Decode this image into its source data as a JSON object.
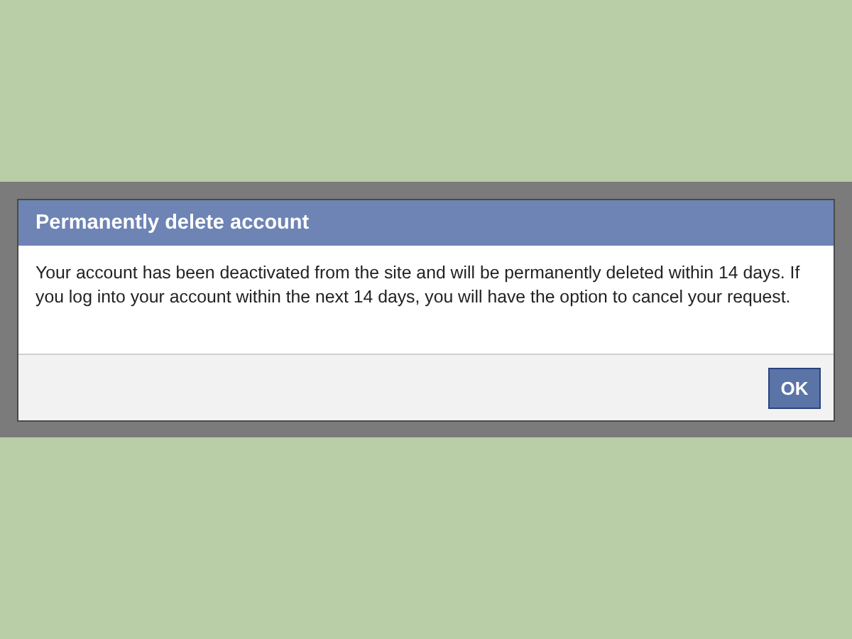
{
  "dialog": {
    "title": "Permanently delete account",
    "message": "Your account has been deactivated from the site and will be permanently deleted within 14 days. If you log into your account within the next 14 days, you will have the option to cancel your request.",
    "buttons": [
      "OK"
    ]
  }
}
